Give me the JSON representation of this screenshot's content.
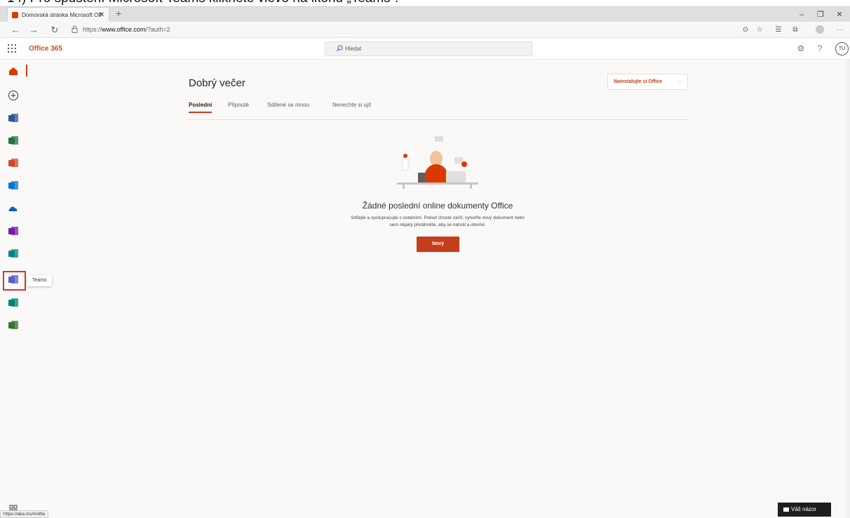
{
  "caption": "14) Pro spuštění Microsoft Teams klikněte vlevo na ikonu „Teams“.",
  "browser": {
    "tab_title": "Domovská stránka Microsoft Off",
    "tab_close": "✕",
    "new_tab": "+",
    "url_prefix": "https://",
    "url_host": "www.office.com",
    "url_path": "/?auth=2",
    "status_url": "https://aka.ms/mstfw"
  },
  "office_bar": {
    "brand": "Office 365",
    "search_placeholder": "Hledat",
    "help": "?",
    "user_initials": "TU"
  },
  "rail": {
    "items": [
      {
        "name": "home",
        "color": "#d83b01"
      },
      {
        "name": "create",
        "color": "#ffffff"
      },
      {
        "name": "word",
        "color": "#2b579a"
      },
      {
        "name": "excel",
        "color": "#217346"
      },
      {
        "name": "powerpoint",
        "color": "#d24726"
      },
      {
        "name": "outlook",
        "color": "#0078d4"
      },
      {
        "name": "onedrive",
        "color": "#0364b8"
      },
      {
        "name": "onenote",
        "color": "#7719aa"
      },
      {
        "name": "sharepoint",
        "color": "#038387"
      },
      {
        "name": "teams",
        "color": "#5b5fc7"
      },
      {
        "name": "sway",
        "color": "#008272"
      },
      {
        "name": "planner",
        "color": "#31752f"
      }
    ],
    "tooltip": "Teams"
  },
  "main": {
    "greeting": "Dobrý večer",
    "install_label": "Nainstalujte si Office",
    "tabs": [
      "Poslední",
      "Připnuté",
      "Sdílené se mnou",
      "Nenechte si ujít"
    ],
    "empty_title": "Žádné poslední online dokumenty Office",
    "empty_line1": "Sdílejte a spolupracujte s ostatními. Pokud chcete začít, vytvořte nový dokument nebo",
    "empty_line2": "sem nějaký přetáhněte, aby se nahrál a otevřel.",
    "new_button": "Nový"
  },
  "feedback": "Váš názor",
  "colors": {
    "accent": "#c43e1c",
    "brand": "#d24726",
    "highlight": "#d13438"
  }
}
